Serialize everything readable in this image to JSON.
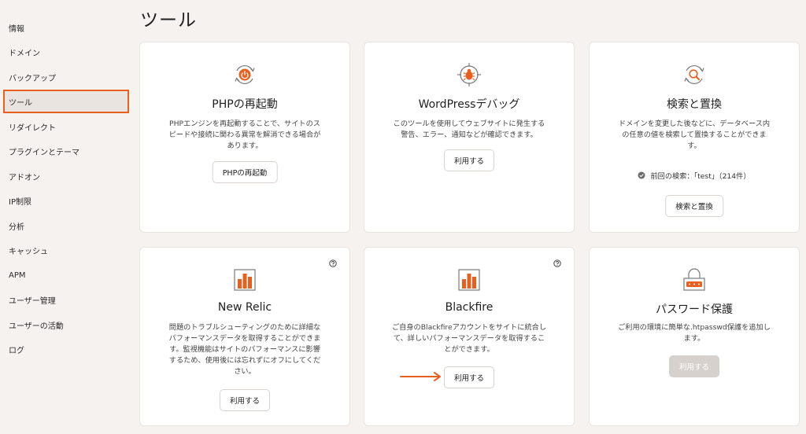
{
  "sidebar": {
    "items": [
      {
        "label": "情報"
      },
      {
        "label": "ドメイン"
      },
      {
        "label": "バックアップ"
      },
      {
        "label": "ツール"
      },
      {
        "label": "リダイレクト"
      },
      {
        "label": "プラグインとテーマ"
      },
      {
        "label": "アドオン"
      },
      {
        "label": "IP制限"
      },
      {
        "label": "分析"
      },
      {
        "label": "キャッシュ"
      },
      {
        "label": "APM"
      },
      {
        "label": "ユーザー管理"
      },
      {
        "label": "ユーザーの活動"
      },
      {
        "label": "ログ"
      }
    ],
    "active": "ツール"
  },
  "page": {
    "title": "ツール"
  },
  "cards": {
    "php": {
      "icon": "power-icon",
      "title": "PHPの再起動",
      "desc1": "PHPエンジンを再起動することで、サイトのス",
      "desc2": "ピードや接続に関わる異常を解消できる場合が",
      "desc3": "あります。",
      "button": "PHPの再起動"
    },
    "debug": {
      "icon": "bug-icon",
      "title": "WordPressデバッグ",
      "desc1": "このツールを使用してウェブサイトに発生する",
      "desc2": "警告、エラー、通知などが確認できます。",
      "button": "利用する"
    },
    "search": {
      "icon": "search-icon",
      "title": "検索と置換",
      "desc1": "ドメインを変更した後などに、データベース内",
      "desc2": "の任意の値を検索して置換することができま",
      "desc3": "す。",
      "status": "前回の検索：「test」（214件）",
      "button": "検索と置換"
    },
    "newrelic": {
      "icon": "bar-chart-icon",
      "title": "New Relic",
      "desc1": "問題のトラブルシューティングのために詳細な",
      "desc2": "パフォーマンスデータを取得することができま",
      "desc3": "す。監視機能はサイトのパフォーマンスに影響",
      "desc4": "するため、使用後には忘れずにオフにしてくだ",
      "desc5": "さい。",
      "button": "利用する"
    },
    "blackfire": {
      "icon": "bar-chart-icon",
      "title": "Blackfire",
      "desc1": "ご自身のBlackfireアカウントをサイトに統合し",
      "desc2": "て、詳しいパフォーマンスデータを取得するこ",
      "desc3": "とができます。",
      "button": "利用する"
    },
    "password": {
      "icon": "lock-icon",
      "title": "パスワード保護",
      "desc1": "ご利用の環境に簡単な.htpasswd保護を追加し",
      "desc2": "ます。",
      "button": "利用する"
    }
  },
  "colors": {
    "accent": "#e8601f",
    "background": "#f5f2ef",
    "card": "#ffffff",
    "disabled_button": "#d6d1cc"
  }
}
